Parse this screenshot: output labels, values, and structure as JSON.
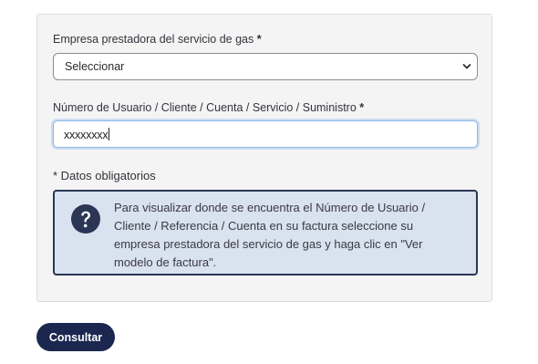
{
  "form": {
    "provider_label": "Empresa prestadora del servicio de gas",
    "provider_required_mark": "*",
    "provider_select_value": "Seleccionar",
    "user_label": "Número de Usuario / Cliente / Cuenta / Servicio / Suministro",
    "user_required_mark": "*",
    "user_input_value": "xxxxxxxx",
    "mandatory_note": "* Datos obligatorios"
  },
  "info_box": {
    "icon": "question-circle-icon",
    "text": "Para visualizar donde se encuentra el Número de Usuario / Cliente / Referencia / Cuenta en su factura seleccione su empresa prestadora del servicio de gas y haga clic en \"Ver modelo de factura\"."
  },
  "actions": {
    "submit_label": "Consultar"
  },
  "colors": {
    "button_bg": "#1c2750",
    "info_bg": "#d9e2ef",
    "info_border": "#2a3654",
    "icon_color": "#2a3654",
    "input_focus": "#8bb8e8"
  }
}
